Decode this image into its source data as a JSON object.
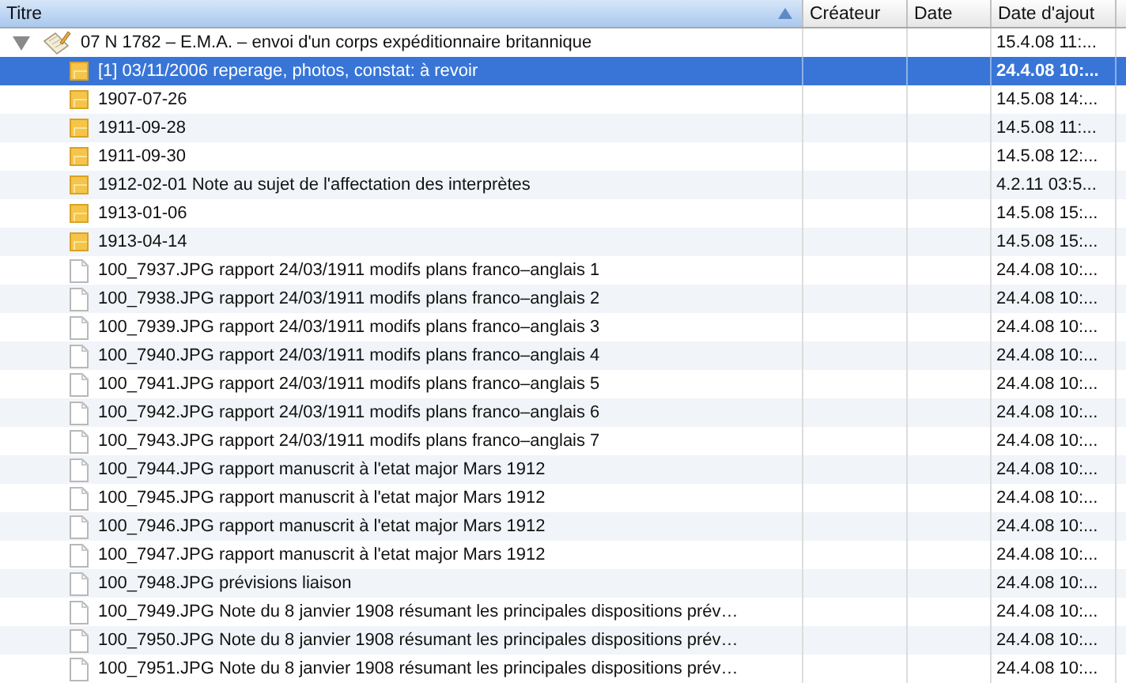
{
  "columns": [
    {
      "label": "Titre",
      "sorted": true
    },
    {
      "label": "Créateur",
      "sorted": false
    },
    {
      "label": "Date",
      "sorted": false
    },
    {
      "label": "Date d'ajout",
      "sorted": false
    }
  ],
  "items": [
    {
      "title": "07 N 1782 – E.M.A. – envoi d'un corps expéditionnaire britannique",
      "date_added": "15.4.08 11:...",
      "expanded": true,
      "selected": false,
      "children": [
        {
          "kind": "note",
          "title": "[1] 03/11/2006 reperage, photos, constat: à revoir",
          "date_added": "24.4.08 10:...",
          "selected": true
        },
        {
          "kind": "note",
          "title": "1907-07-26",
          "date_added": "14.5.08 14:...",
          "selected": false
        },
        {
          "kind": "note",
          "title": "1911-09-28",
          "date_added": "14.5.08 11:...",
          "selected": false
        },
        {
          "kind": "note",
          "title": "1911-09-30",
          "date_added": "14.5.08 12:...",
          "selected": false
        },
        {
          "kind": "note",
          "title": "1912-02-01 Note au sujet de l'affectation des interprètes",
          "date_added": "4.2.11 03:5...",
          "selected": false
        },
        {
          "kind": "note",
          "title": "1913-01-06",
          "date_added": "14.5.08 15:...",
          "selected": false
        },
        {
          "kind": "note",
          "title": "1913-04-14",
          "date_added": "14.5.08 15:...",
          "selected": false
        },
        {
          "kind": "file",
          "title": "100_7937.JPG rapport 24/03/1911 modifs plans franco–anglais 1",
          "date_added": "24.4.08 10:...",
          "selected": false
        },
        {
          "kind": "file",
          "title": "100_7938.JPG rapport 24/03/1911 modifs plans franco–anglais 2",
          "date_added": "24.4.08 10:...",
          "selected": false
        },
        {
          "kind": "file",
          "title": "100_7939.JPG rapport 24/03/1911 modifs plans franco–anglais 3",
          "date_added": "24.4.08 10:...",
          "selected": false
        },
        {
          "kind": "file",
          "title": "100_7940.JPG rapport 24/03/1911 modifs plans franco–anglais 4",
          "date_added": "24.4.08 10:...",
          "selected": false
        },
        {
          "kind": "file",
          "title": "100_7941.JPG rapport 24/03/1911 modifs plans franco–anglais 5",
          "date_added": "24.4.08 10:...",
          "selected": false
        },
        {
          "kind": "file",
          "title": "100_7942.JPG rapport 24/03/1911 modifs plans franco–anglais 6",
          "date_added": "24.4.08 10:...",
          "selected": false
        },
        {
          "kind": "file",
          "title": "100_7943.JPG rapport 24/03/1911 modifs plans franco–anglais 7",
          "date_added": "24.4.08 10:...",
          "selected": false
        },
        {
          "kind": "file",
          "title": "100_7944.JPG rapport manuscrit à l'etat major Mars 1912",
          "date_added": "24.4.08 10:...",
          "selected": false
        },
        {
          "kind": "file",
          "title": "100_7945.JPG rapport manuscrit à l'etat major Mars 1912",
          "date_added": "24.4.08 10:...",
          "selected": false
        },
        {
          "kind": "file",
          "title": "100_7946.JPG rapport manuscrit à l'etat major Mars 1912",
          "date_added": "24.4.08 10:...",
          "selected": false
        },
        {
          "kind": "file",
          "title": "100_7947.JPG rapport manuscrit à l'etat major Mars 1912",
          "date_added": "24.4.08 10:...",
          "selected": false
        },
        {
          "kind": "file",
          "title": "100_7948.JPG prévisions liaison",
          "date_added": "24.4.08 10:...",
          "selected": false
        },
        {
          "kind": "file",
          "title": "100_7949.JPG Note du 8 janvier 1908 résumant les principales dispositions prév…",
          "date_added": "24.4.08 10:...",
          "selected": false
        },
        {
          "kind": "file",
          "title": "100_7950.JPG Note du 8 janvier 1908 résumant les principales dispositions prév…",
          "date_added": "24.4.08 10:...",
          "selected": false
        },
        {
          "kind": "file",
          "title": "100_7951.JPG Note du 8 janvier 1908 résumant les principales dispositions prév…",
          "date_added": "24.4.08 10:...",
          "selected": false
        }
      ]
    }
  ]
}
